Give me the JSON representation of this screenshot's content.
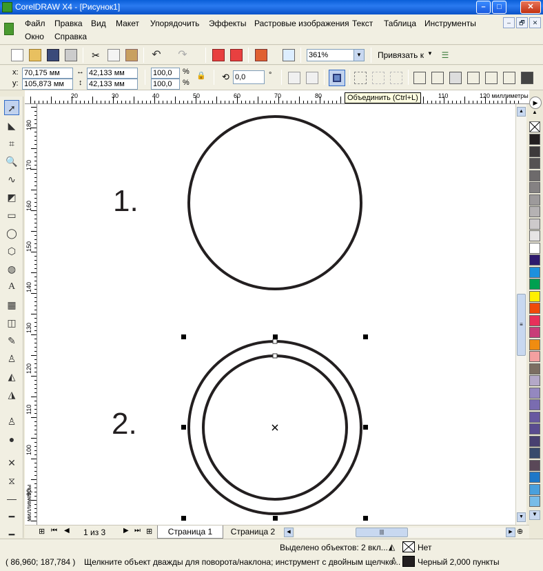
{
  "window": {
    "title": "CorelDRAW X4 - [Рисунок1]",
    "minimize": "–",
    "maximize": "□",
    "close": "✕"
  },
  "menu": {
    "items": [
      "Файл",
      "Правка",
      "Вид",
      "Макет",
      "Упорядочить",
      "Эффекты",
      "Растровые изображения",
      "Текст",
      "Таблица",
      "Инструменты",
      "Окно",
      "Справка"
    ],
    "doc_buttons": [
      "–",
      "🗗",
      "✕"
    ]
  },
  "standard_toolbar": {
    "zoom_value": "361%",
    "snap_label": "Привязать к"
  },
  "property_bar": {
    "x_label": "x:",
    "x_value": "70,175 мм",
    "y_label": "y:",
    "y_value": "105,873 мм",
    "width_value": "42,133 мм",
    "height_value": "42,133 мм",
    "scale_x": "100,0",
    "scale_y": "100,0",
    "percent": "%",
    "angle_value": "0,0",
    "degree": "°"
  },
  "tooltip": {
    "text": "Объединить (Ctrl+L)"
  },
  "rulers": {
    "h_labels": [
      "20",
      "30",
      "40",
      "50",
      "60",
      "70",
      "80",
      "90",
      "110",
      "120 миллиметры"
    ],
    "v_labels": [
      "180",
      "170",
      "160",
      "150",
      "140",
      "130",
      "120",
      "110",
      "100",
      "90",
      "миллиметры"
    ]
  },
  "canvas": {
    "label1": "1.",
    "label2": "2."
  },
  "page_nav": {
    "counter": "1 из 3",
    "tabs": [
      "Страница 1",
      "Страница 2"
    ]
  },
  "status": {
    "selected": "Выделено объектов: 2 вкл...",
    "fill_value": "Нет",
    "coords": "( 86,960; 187,784 )",
    "hint": "Щелкните объект дважды для поворота/наклона; инструмент с двойным щелчко...",
    "outline_value": "Черный  2,000 пункты"
  },
  "palette_colors": [
    "#231f20",
    "#3d3a3b",
    "#555253",
    "#6d6a6b",
    "#858283",
    "#9d9a9b",
    "#b5b2b3",
    "#cdcacb",
    "#e6e4e4",
    "#ffffff",
    "#2e1a6e",
    "#1e90dc",
    "#00a050",
    "#ffef00",
    "#f04a0a",
    "#e8305a",
    "#c83c78",
    "#f08c10",
    "#f4a0a0",
    "#7c6e62",
    "#b4a8c8",
    "#9488c0",
    "#7a6cb0",
    "#6858a0",
    "#5a4c90",
    "#484070",
    "#384a6c",
    "#5a4858",
    "#1e78c8",
    "#4aa0dc",
    "#78bce8"
  ]
}
